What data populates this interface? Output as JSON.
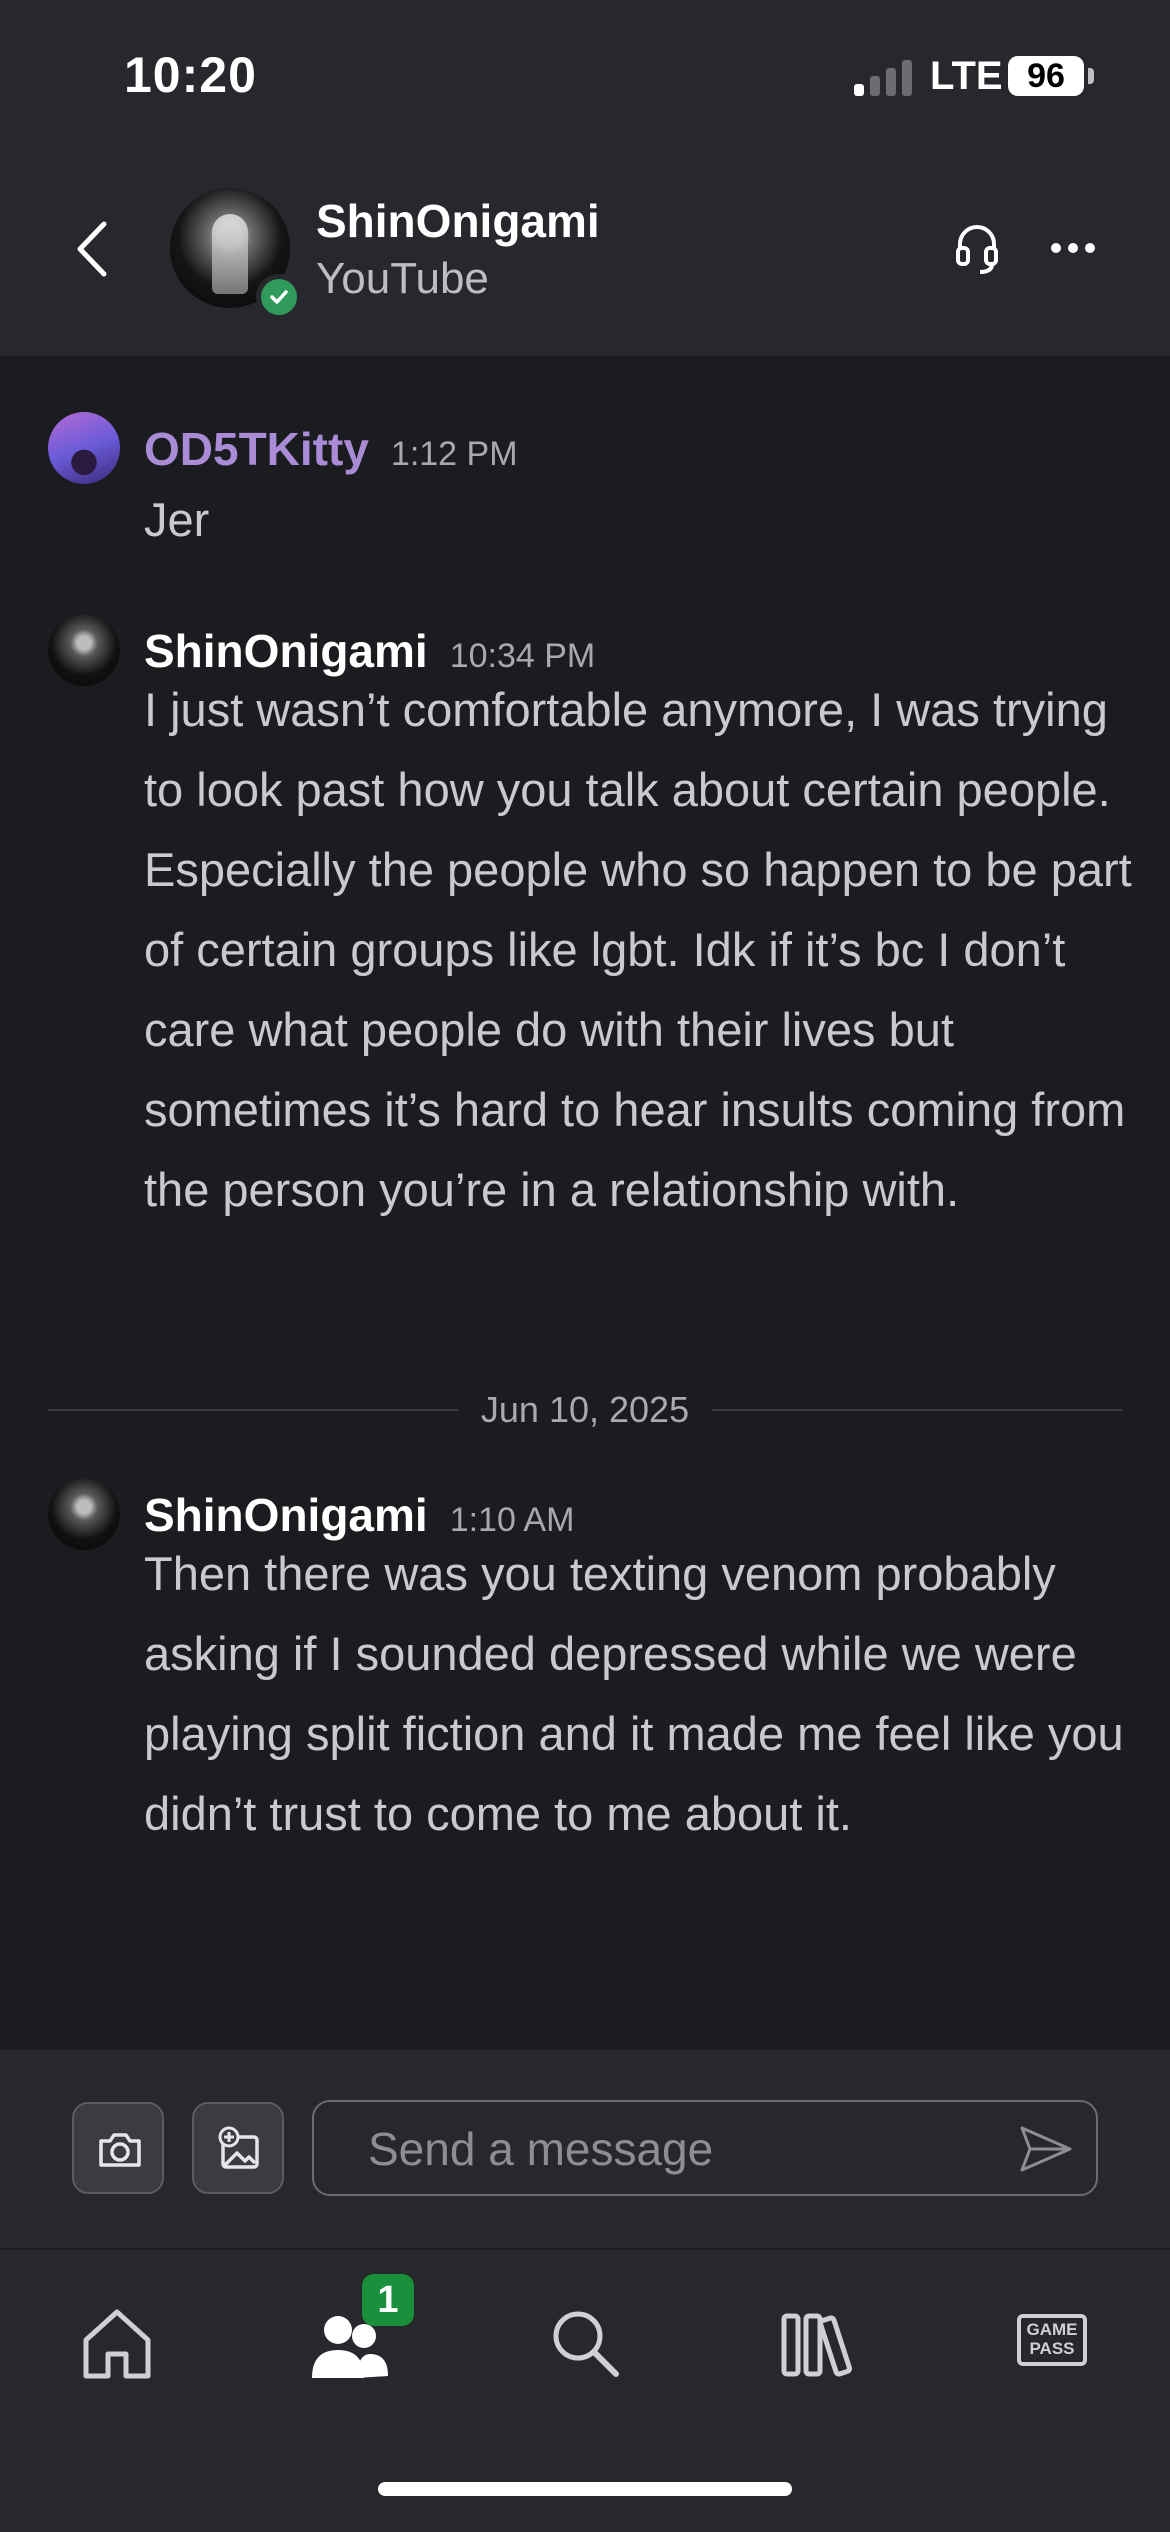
{
  "status_bar": {
    "time": "10:20",
    "network": "LTE",
    "battery": "96"
  },
  "header": {
    "name": "ShinOnigami",
    "subtitle": "YouTube",
    "back_icon": "chevron-left-icon",
    "headset_icon": "headset-icon",
    "more_icon": "more-horizontal-icon"
  },
  "messages": [
    {
      "author": "OD5TKitty",
      "time": "1:12 PM",
      "text": "Jer",
      "color": "#a98bd6"
    },
    {
      "author": "ShinOnigami",
      "time": "10:34 PM",
      "text": "I just wasn’t comfortable anymore, I was trying to look past how you talk about certain people. Especially the people who so happen to be part of certain groups like lgbt. Idk if it’s bc I don’t care what people do with their lives but sometimes it’s hard to hear insults coming from the person you’re in a relationship with.",
      "color": "#ffffff"
    },
    {
      "author": "ShinOnigami",
      "time": "1:10 AM",
      "text": "Then there was you texting venom probably asking if I sounded depressed while we were playing split fiction and it made me feel like you didn’t trust to come to me about it.",
      "color": "#ffffff"
    }
  ],
  "date_divider": "Jun 10, 2025",
  "composer": {
    "placeholder": "Send a message",
    "camera_icon": "camera-icon",
    "image_icon": "add-image-icon",
    "send_icon": "send-icon"
  },
  "tabbar": {
    "items": [
      {
        "name": "home-icon"
      },
      {
        "name": "friends-icon",
        "badge": "1"
      },
      {
        "name": "search-icon"
      },
      {
        "name": "library-icon"
      },
      {
        "name": "game-pass-icon",
        "label": "GAME PASS"
      }
    ]
  },
  "colors": {
    "background": "#1b1c20",
    "header": "#26282d",
    "accent_green": "#1a8f3c",
    "kitty_purple": "#a98bd6"
  }
}
